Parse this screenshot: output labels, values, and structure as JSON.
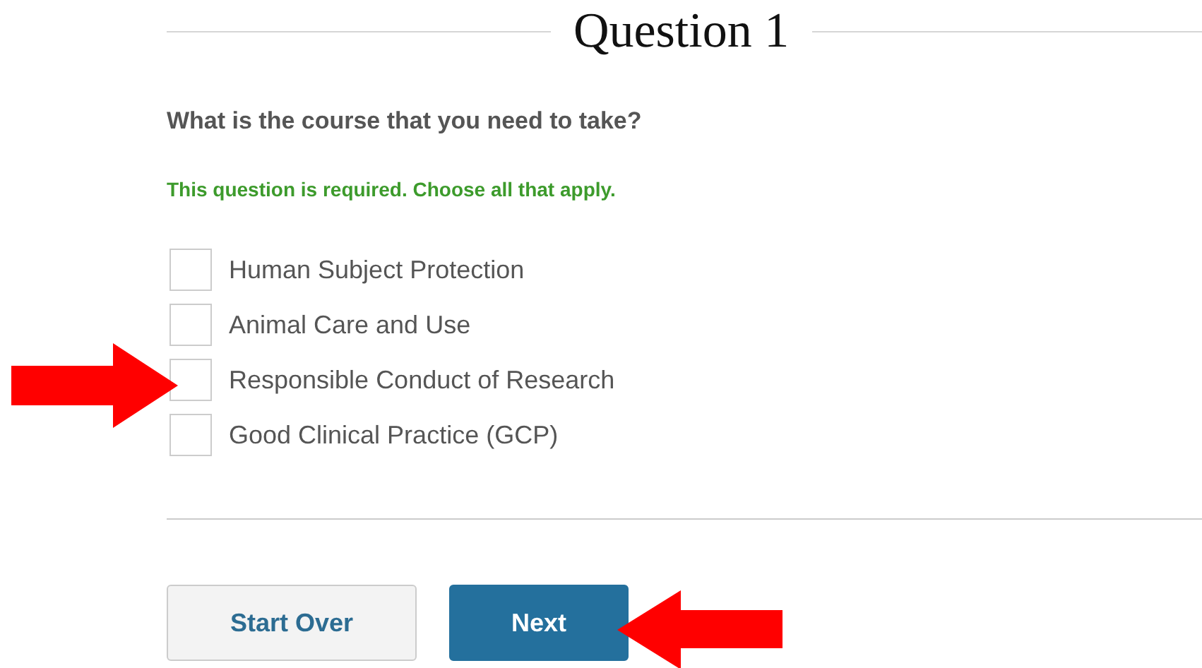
{
  "heading": "Question 1",
  "question": "What is the course that you need to take?",
  "hint": "This question is required. Choose all that apply.",
  "options": [
    {
      "label": "Human Subject Protection",
      "checked": false
    },
    {
      "label": "Animal Care and Use",
      "checked": false
    },
    {
      "label": "Responsible Conduct of Research",
      "checked": false
    },
    {
      "label": "Good Clinical Practice (GCP)",
      "checked": false
    }
  ],
  "buttons": [
    {
      "label": "Start Over",
      "kind": "secondary"
    },
    {
      "label": "Next",
      "kind": "primary"
    }
  ]
}
